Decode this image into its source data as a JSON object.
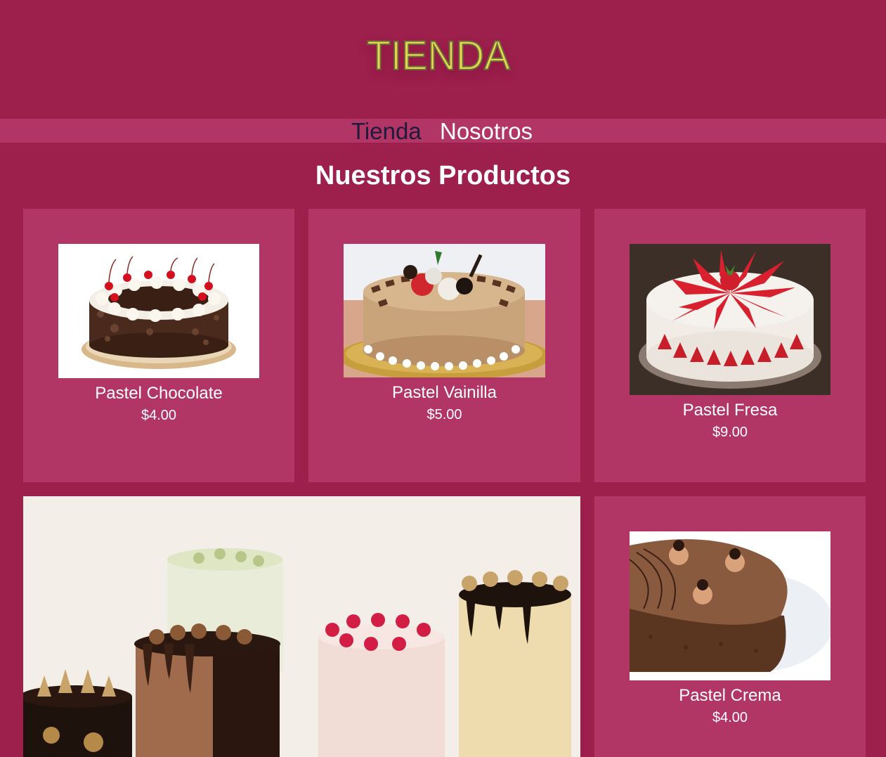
{
  "brand": {
    "logo_text": "TIENDA"
  },
  "nav": {
    "items": [
      {
        "label": "Tienda"
      },
      {
        "label": "Nosotros"
      }
    ]
  },
  "main": {
    "title": "Nuestros Productos"
  },
  "products": [
    {
      "name": "Pastel Chocolate",
      "price": "$4.00",
      "image": "black-forest-cake-image"
    },
    {
      "name": "Pastel Vainilla",
      "price": "$5.00",
      "image": "vanilla-cake-image"
    },
    {
      "name": "Pastel Fresa",
      "price": "$9.00",
      "image": "strawberry-cake-image"
    },
    {
      "name": "Pastel Crema",
      "price": "$4.00",
      "image": "cream-cake-image"
    }
  ],
  "hero": {
    "image": "assorted-cakes-banner-image"
  },
  "colors": {
    "background": "#9c1f4c",
    "card": "#b23665",
    "logo": "#e6d64f",
    "nav_active": "#1e1b3d"
  }
}
